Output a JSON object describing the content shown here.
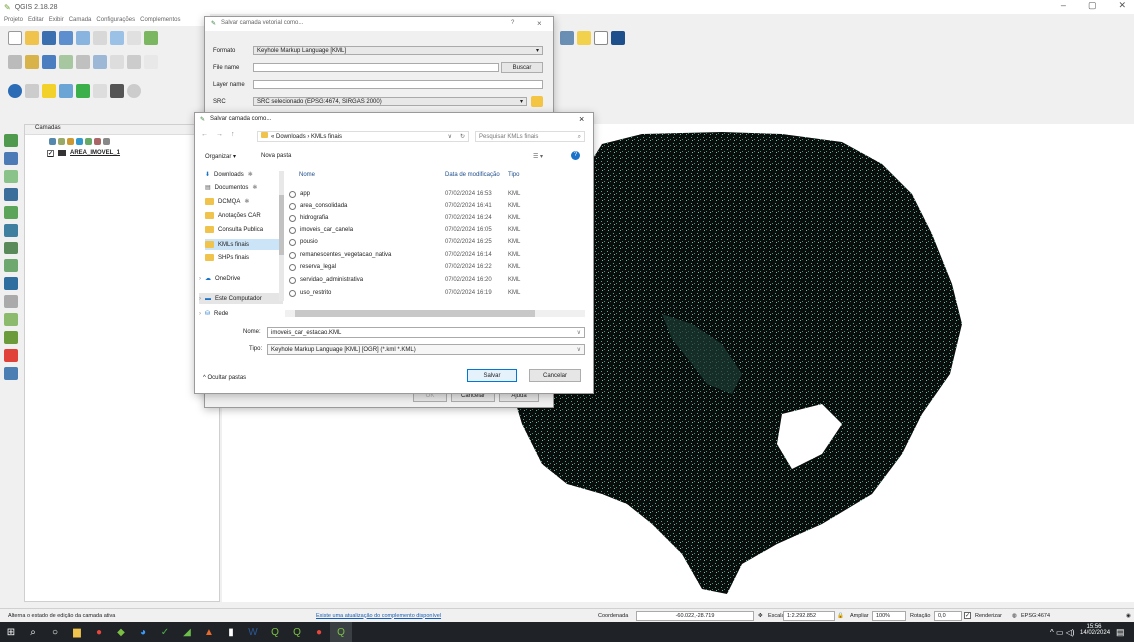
{
  "app": {
    "title": "QGIS 2.18.28",
    "menu": [
      "Projeto",
      "Editar",
      "Exibir",
      "Camada",
      "Configurações",
      "Complementos"
    ]
  },
  "layers": {
    "panel_title": "Camadas",
    "layer_name": "AREA_IMOVEL_1"
  },
  "vector_dialog": {
    "title": "Salvar camada vetorial como...",
    "help": "?",
    "close": "×",
    "format_label": "Formato",
    "format_value": "Keyhole Markup Language [KML]",
    "filename_label": "File name",
    "filename_value": "",
    "browse_label": "Buscar",
    "layername_label": "Layer name",
    "layername_value": "",
    "src_label": "SRC",
    "src_value": "SRC selecionado (EPSG:4674, SIRGAS 2000)",
    "ok_label": "OK",
    "cancel_label": "Cancelar",
    "help_label": "Ajuda"
  },
  "file_dialog": {
    "title": "Salvar camada como...",
    "breadcrumb": "« Downloads › KMLs finais",
    "search_placeholder": "Pesquisar KMLs finais",
    "organize_label": "Organizar ▾",
    "newfolder_label": "Nova pasta",
    "col_name": "Nome",
    "col_date": "Data de modificação",
    "col_type": "Tipo",
    "sidebar": [
      {
        "label": "Downloads"
      },
      {
        "label": "Documentos"
      },
      {
        "label": "DCMQA"
      },
      {
        "label": "Anotações CAR"
      },
      {
        "label": "Consulta Publica"
      },
      {
        "label": "KMLs finais"
      },
      {
        "label": "SHPs finais"
      },
      {
        "label": "OneDrive"
      },
      {
        "label": "Este Computador"
      },
      {
        "label": "Rede"
      }
    ],
    "files": [
      {
        "name": "app",
        "date": "07/02/2024 16:53",
        "type": "KML"
      },
      {
        "name": "area_consolidada",
        "date": "07/02/2024 16:41",
        "type": "KML"
      },
      {
        "name": "hidrografia",
        "date": "07/02/2024 16:24",
        "type": "KML"
      },
      {
        "name": "imoveis_car_canela",
        "date": "07/02/2024 16:05",
        "type": "KML"
      },
      {
        "name": "pousio",
        "date": "07/02/2024 16:25",
        "type": "KML"
      },
      {
        "name": "remanescentes_vegetacao_nativa",
        "date": "07/02/2024 16:14",
        "type": "KML"
      },
      {
        "name": "reserva_legal",
        "date": "07/02/2024 16:22",
        "type": "KML"
      },
      {
        "name": "servidao_administrativa",
        "date": "07/02/2024 16:20",
        "type": "KML"
      },
      {
        "name": "uso_restrito",
        "date": "07/02/2024 16:19",
        "type": "KML"
      }
    ],
    "name_label": "Nome:",
    "name_value": "imoveis_car_estacao.KML",
    "type_label": "Tipo:",
    "type_value": "Keyhole Markup Language [KML] [OGR] (*.kml *.KML)",
    "hide_folders": "Ocultar pastas",
    "save_label": "Salvar",
    "cancel_label": "Cancelar"
  },
  "status": {
    "left": "Alterna o estado de edição da camada ativa",
    "update_link": "Existe uma atualização do complemento disponível",
    "coord_label": "Coordenada",
    "coord_value": "-60.022,-28.719",
    "scale_label": "Escala",
    "scale_value": "1:2.292.852",
    "zoom_label": "Ampliar",
    "zoom_value": "100%",
    "rotation_label": "Rotação",
    "rotation_value": "0,0",
    "render_label": "Renderizar",
    "crs_value": "EPSG:4674"
  },
  "taskbar": {
    "time": "15:56",
    "date": "14/02/2024"
  }
}
